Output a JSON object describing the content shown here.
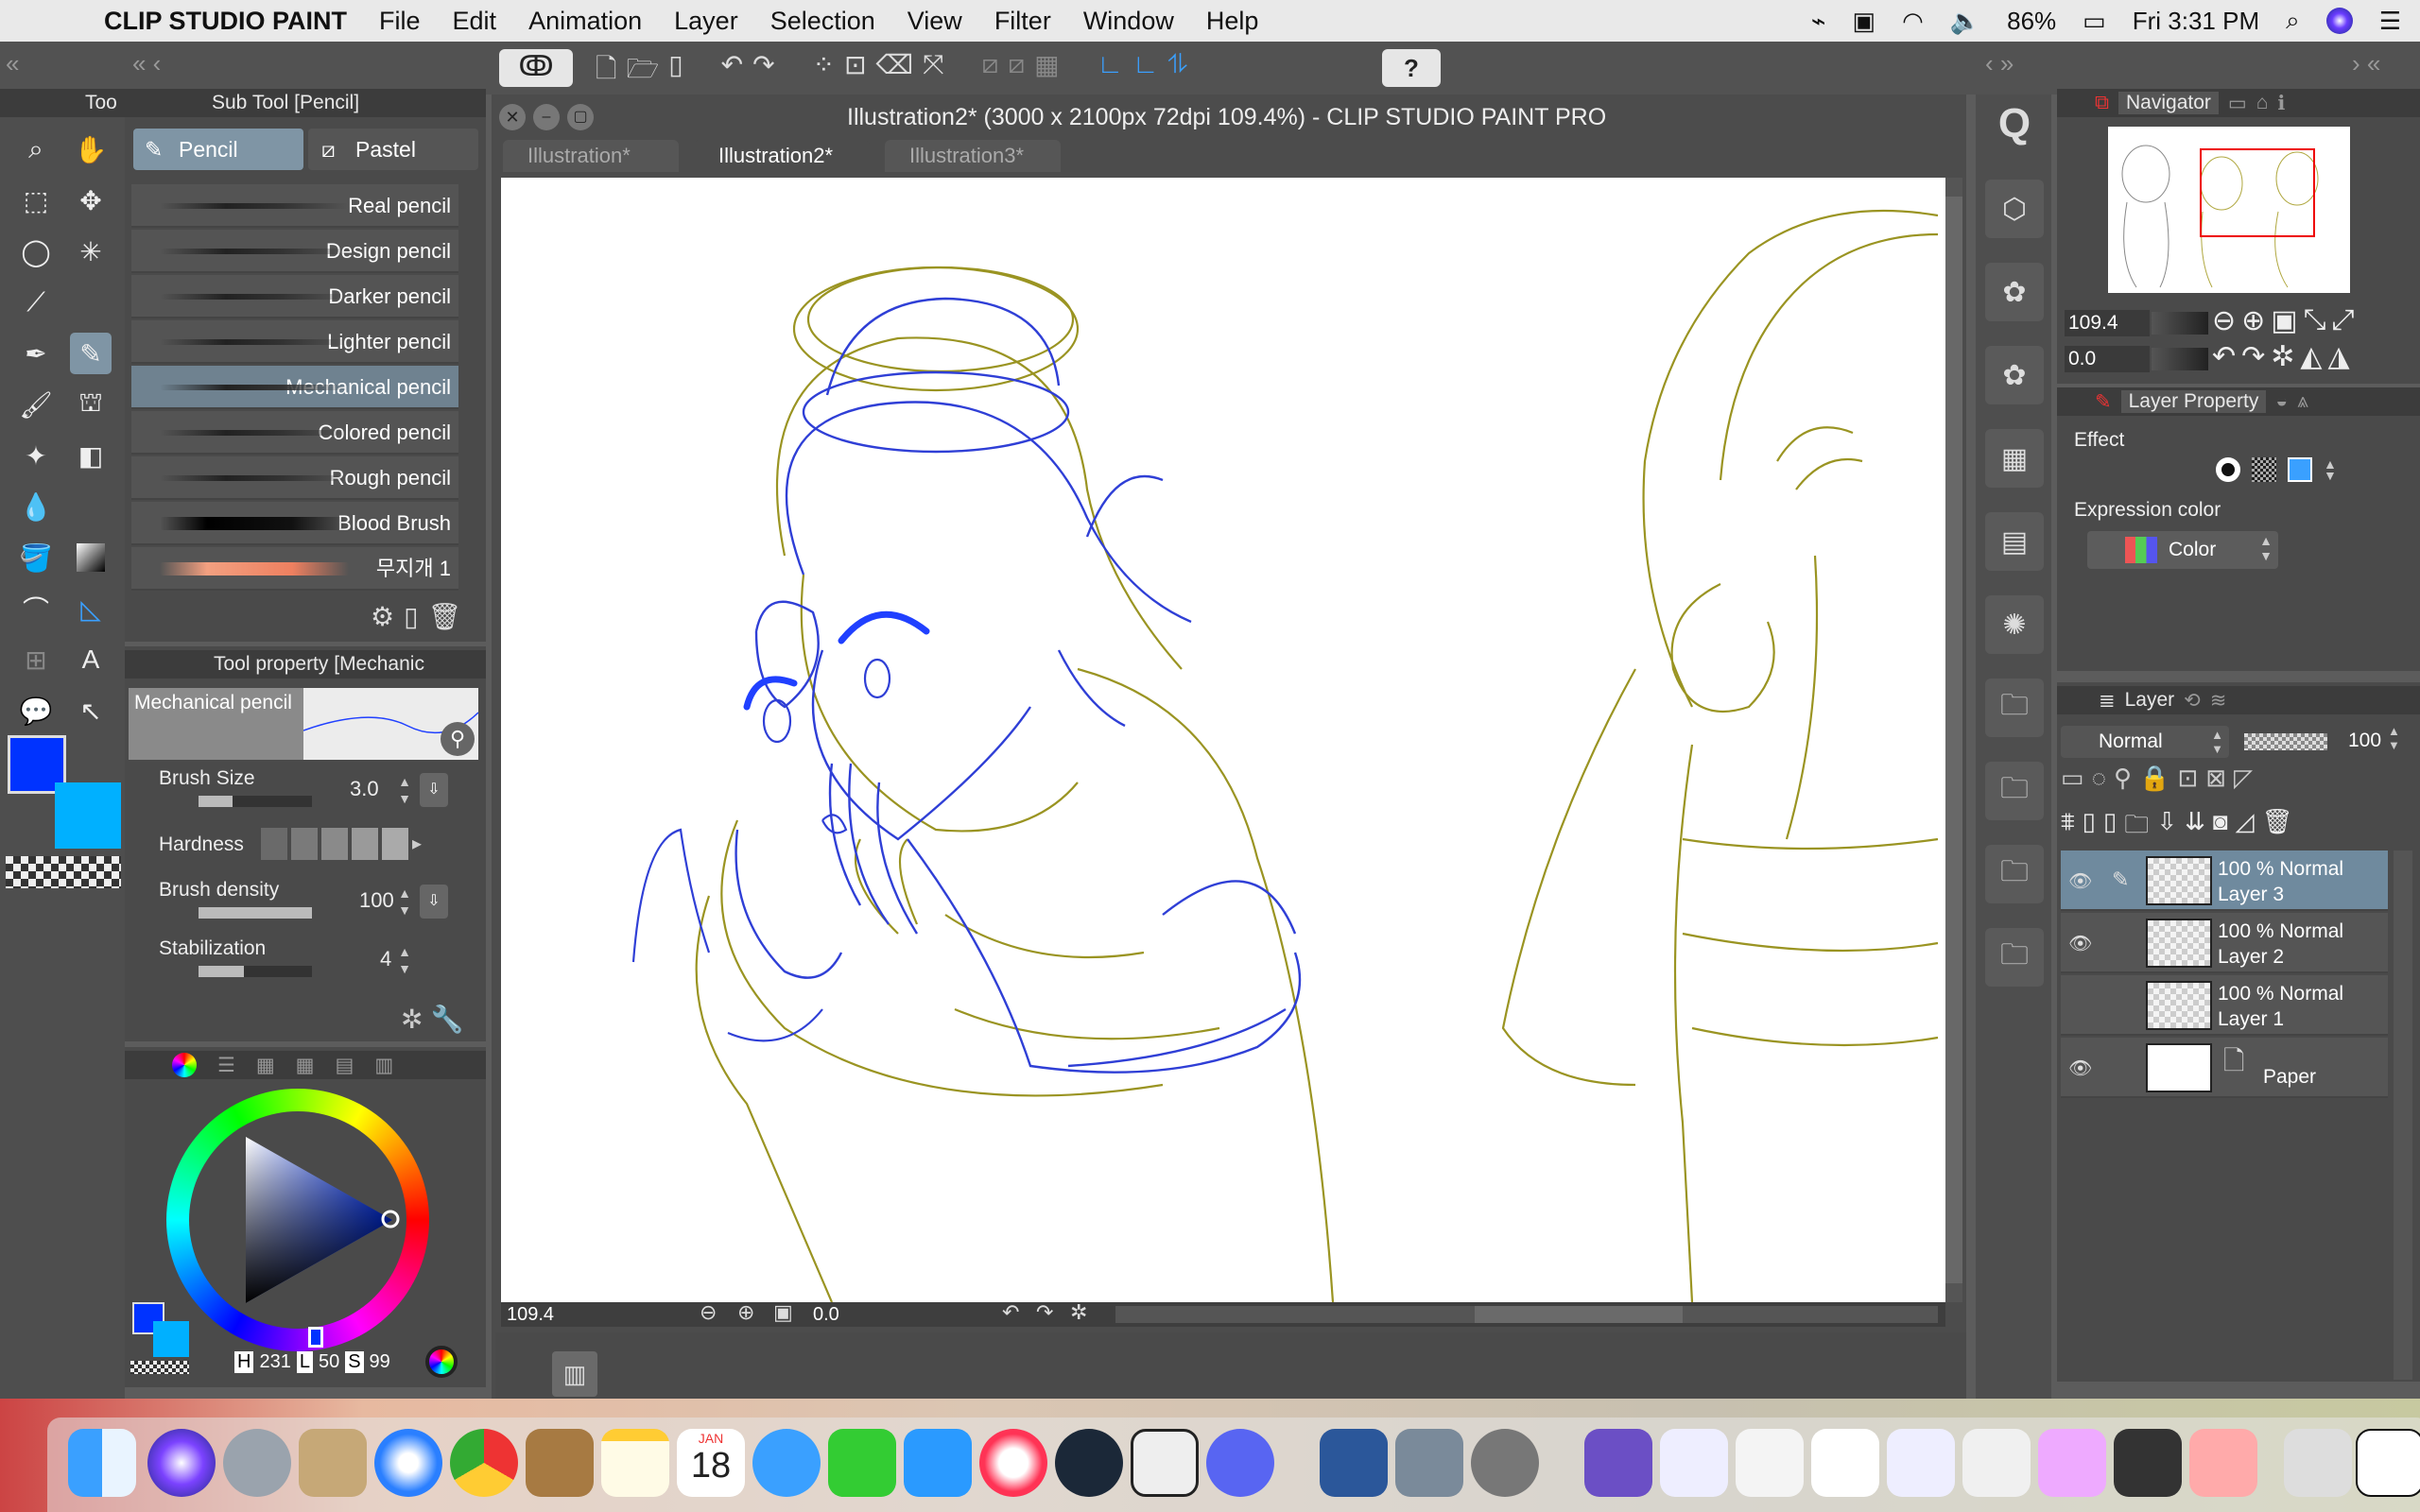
{
  "menubar": {
    "app": "CLIP STUDIO PAINT",
    "items": [
      "File",
      "Edit",
      "Animation",
      "Layer",
      "Selection",
      "View",
      "Filter",
      "Window",
      "Help"
    ],
    "battery": "86%",
    "clock": "Fri 3:31 PM"
  },
  "window": {
    "title": "Illustration2* (3000 x 2100px 72dpi 109.4%)  - CLIP STUDIO PAINT PRO",
    "tabs": [
      "Illustration*",
      "Illustration2*",
      "Illustration3*"
    ]
  },
  "tool_panel": {
    "title": "Too"
  },
  "subtool": {
    "title": "Sub Tool [Pencil]",
    "tabs": [
      "Pencil",
      "Pastel"
    ],
    "brushes": [
      "Real pencil",
      "Design pencil",
      "Darker pencil",
      "Lighter pencil",
      "Mechanical pencil",
      "Colored pencil",
      "Rough pencil",
      "Blood Brush",
      "무지개 1"
    ],
    "selected": "Mechanical pencil"
  },
  "tool_property": {
    "title": "Tool property [Mechanic",
    "preview_name": "Mechanical pencil",
    "brush_size_label": "Brush Size",
    "brush_size": "3.0",
    "brush_size_fraction": 0.3,
    "hardness_label": "Hardness",
    "brush_density_label": "Brush density",
    "brush_density": "100",
    "stabilization_label": "Stabilization",
    "stabilization": "4",
    "stabilization_fraction": 0.4
  },
  "color": {
    "main": "#0033ff",
    "sub": "#00b0ff",
    "h_label": "H",
    "h": "231",
    "l_label": "L",
    "l": "50",
    "s_label": "S",
    "s": "99"
  },
  "status": {
    "zoom": "109.4",
    "angle": "0.0"
  },
  "navigator": {
    "title": "Navigator",
    "zoom": "109.4",
    "angle": "0.0"
  },
  "layer_property": {
    "title": "Layer Property",
    "effect_label": "Effect",
    "expression_label": "Expression color",
    "expression_value": "Color"
  },
  "layer_panel": {
    "title": "Layer",
    "blend": "Normal",
    "opacity": "100",
    "layers": [
      {
        "meta": "100 % Normal",
        "name": "Layer 3",
        "selected": true
      },
      {
        "meta": "100 % Normal",
        "name": "Layer 2",
        "selected": false
      },
      {
        "meta": "100 % Normal",
        "name": "Layer 1",
        "selected": false
      }
    ],
    "paper": "Paper"
  },
  "dock": {
    "calendar_month": "JAN",
    "calendar_day": "18"
  }
}
